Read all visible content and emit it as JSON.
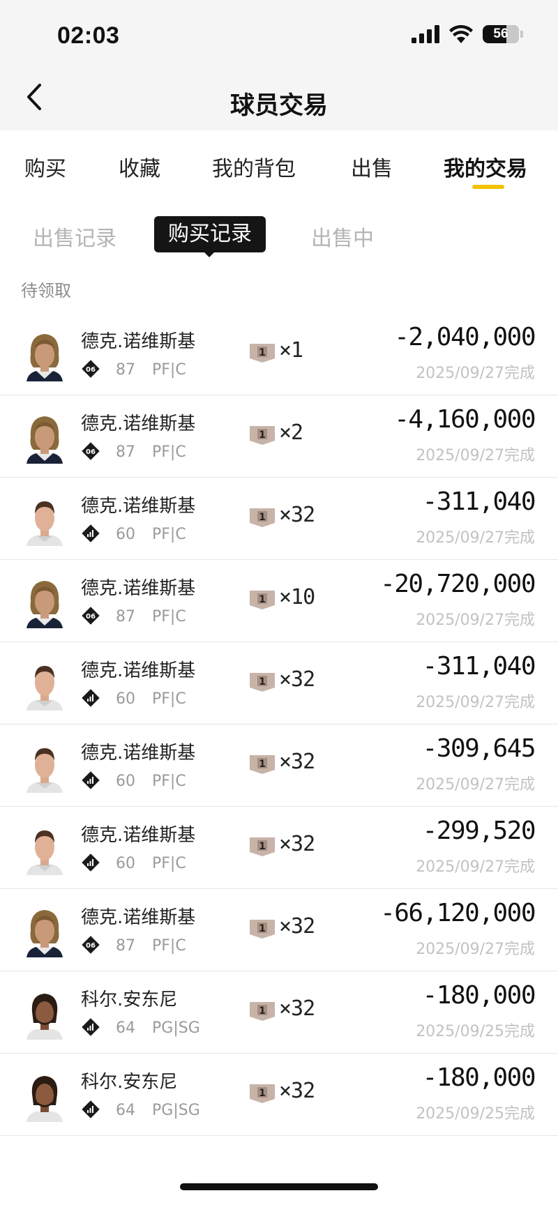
{
  "status_bar": {
    "time": "02:03",
    "battery": "56"
  },
  "nav": {
    "title": "球员交易"
  },
  "top_tabs": [
    {
      "label": "购买"
    },
    {
      "label": "收藏"
    },
    {
      "label": "我的背包"
    },
    {
      "label": "出售"
    },
    {
      "label": "我的交易",
      "active": true
    }
  ],
  "sub_tabs": [
    {
      "label": "出售记录"
    },
    {
      "label": "购买记录",
      "active": true
    },
    {
      "label": "出售中"
    }
  ],
  "section_label": "待领取",
  "colors": {
    "accent": "#f2c200",
    "card": "#c7b3a8"
  },
  "rows": [
    {
      "name": "德克.诺维斯基",
      "badge": "06",
      "rating": "87",
      "position": "PF|C",
      "card": "1",
      "qty": "×1",
      "price": "-2,040,000",
      "date": "2025/09/27完成",
      "avatar": "dirk-long-hair"
    },
    {
      "name": "德克.诺维斯基",
      "badge": "06",
      "rating": "87",
      "position": "PF|C",
      "card": "1",
      "qty": "×2",
      "price": "-4,160,000",
      "date": "2025/09/27完成",
      "avatar": "dirk-long-hair"
    },
    {
      "name": "德克.诺维斯基",
      "badge": "bars-icon",
      "rating": "60",
      "position": "PF|C",
      "card": "1",
      "qty": "×32",
      "price": "-311,040",
      "date": "2025/09/27完成",
      "avatar": "dirk-short-hair"
    },
    {
      "name": "德克.诺维斯基",
      "badge": "06",
      "rating": "87",
      "position": "PF|C",
      "card": "1",
      "qty": "×10",
      "price": "-20,720,000",
      "date": "2025/09/27完成",
      "avatar": "dirk-long-hair"
    },
    {
      "name": "德克.诺维斯基",
      "badge": "bars-icon",
      "rating": "60",
      "position": "PF|C",
      "card": "1",
      "qty": "×32",
      "price": "-311,040",
      "date": "2025/09/27完成",
      "avatar": "dirk-short-hair"
    },
    {
      "name": "德克.诺维斯基",
      "badge": "bars-icon",
      "rating": "60",
      "position": "PF|C",
      "card": "1",
      "qty": "×32",
      "price": "-309,645",
      "date": "2025/09/27完成",
      "avatar": "dirk-short-hair"
    },
    {
      "name": "德克.诺维斯基",
      "badge": "bars-icon",
      "rating": "60",
      "position": "PF|C",
      "card": "1",
      "qty": "×32",
      "price": "-299,520",
      "date": "2025/09/27完成",
      "avatar": "dirk-short-hair"
    },
    {
      "name": "德克.诺维斯基",
      "badge": "06",
      "rating": "87",
      "position": "PF|C",
      "card": "1",
      "qty": "×32",
      "price": "-66,120,000",
      "date": "2025/09/27完成",
      "avatar": "dirk-long-hair"
    },
    {
      "name": "科尔.安东尼",
      "badge": "bars-icon",
      "rating": "64",
      "position": "PG|SG",
      "card": "1",
      "qty": "×32",
      "price": "-180,000",
      "date": "2025/09/25完成",
      "avatar": "cole-braids"
    },
    {
      "name": "科尔.安东尼",
      "badge": "bars-icon",
      "rating": "64",
      "position": "PG|SG",
      "card": "1",
      "qty": "×32",
      "price": "-180,000",
      "date": "2025/09/25完成",
      "avatar": "cole-braids"
    }
  ]
}
